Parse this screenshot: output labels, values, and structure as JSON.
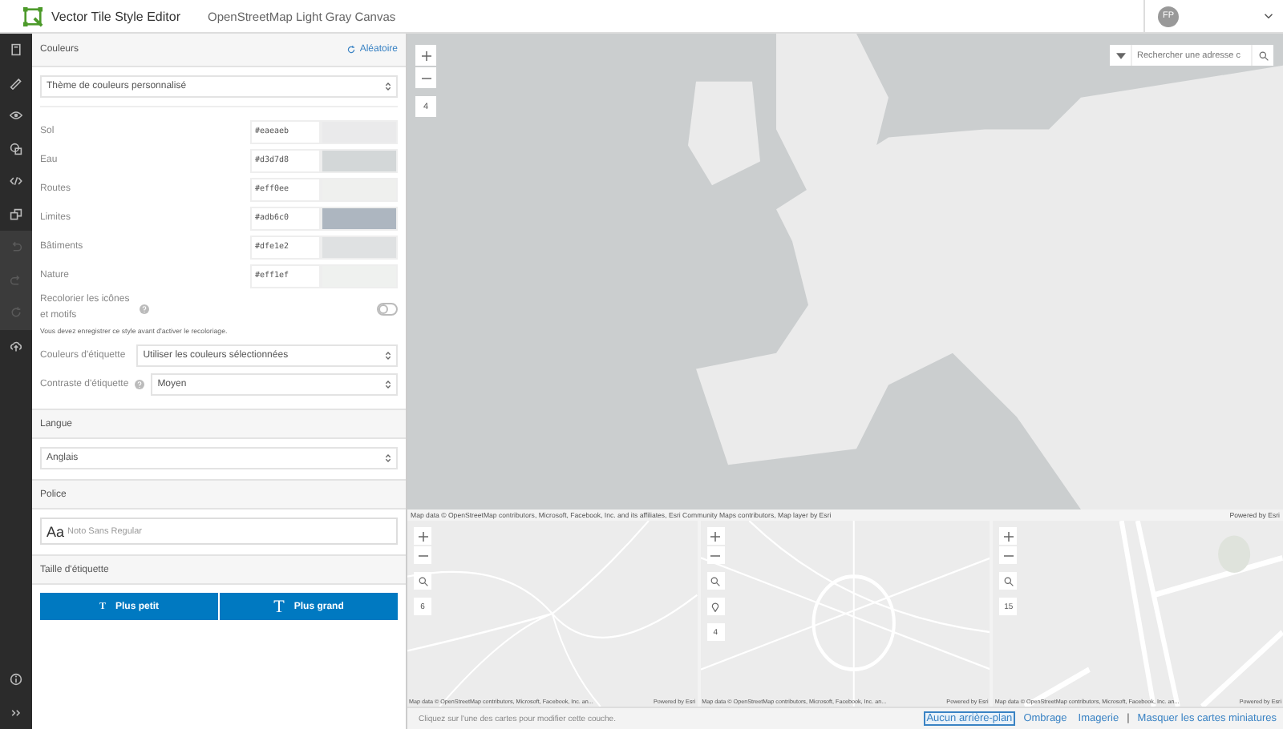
{
  "header": {
    "app_title": "Vector Tile Style Editor",
    "map_title": "OpenStreetMap Light Gray Canvas",
    "user": {
      "initials": "FP"
    }
  },
  "rail": {
    "items": [
      {
        "disabled": false
      },
      {
        "disabled": false
      },
      {
        "disabled": false
      },
      {
        "disabled": false
      },
      {
        "disabled": false
      },
      {
        "disabled": false
      },
      {
        "disabled": true
      },
      {
        "disabled": true
      },
      {
        "disabled": true
      },
      {
        "disabled": false
      }
    ]
  },
  "colors": {
    "title": "Couleurs",
    "random": "Aléatoire",
    "theme": "Thème de couleurs personnalisé",
    "rows": [
      {
        "label": "Sol",
        "hex": "#eaeaeb",
        "color": "#eaeaeb"
      },
      {
        "label": "Eau",
        "hex": "#d3d7d8",
        "color": "#d3d7d8"
      },
      {
        "label": "Routes",
        "hex": "#eff0ee",
        "color": "#eff0ee"
      },
      {
        "label": "Limites",
        "hex": "#adb6c0",
        "color": "#adb6c0"
      },
      {
        "label": "Bâtiments",
        "hex": "#dfe1e2",
        "color": "#dfe1e2"
      },
      {
        "label": "Nature",
        "hex": "#eff1ef",
        "color": "#eff1ef"
      }
    ],
    "recolor": {
      "label": "Recolorier les icônes et motifs",
      "on": false,
      "note": "Vous devez enregistrer ce style avant d'activer le recoloriage."
    },
    "selects": [
      {
        "label": "Couleurs d'étiquette",
        "value": "Utiliser les couleurs sélectionnées",
        "help": false
      },
      {
        "label": "Contraste d'étiquette",
        "value": "Moyen",
        "help": true
      }
    ]
  },
  "language": {
    "title": "Langue",
    "value": "Anglais"
  },
  "font": {
    "title": "Police",
    "sample": "Aa",
    "value": "Noto Sans Regular"
  },
  "label_size": {
    "title": "Taille d'étiquette",
    "buttons": [
      {
        "icon": "T",
        "label": "Plus petit",
        "kind": "smaller"
      },
      {
        "icon": "T",
        "label": "Plus grand",
        "kind": "larger"
      }
    ]
  },
  "map": {
    "zoom_level": "4",
    "search": {
      "placeholder": "Rechercher une adresse c"
    },
    "attribution": "Map data © OpenStreetMap contributors, Microsoft, Facebook, Inc. and its affiliates, Esri Community Maps contributors, Map layer by Esri",
    "powered": "Powered by Esri"
  },
  "minimaps": [
    {
      "zoom_level": "6",
      "pin": false,
      "attribution": "Map data © OpenStreetMap contributors, Microsoft, Facebook, Inc. an...",
      "powered": "Powered by Esri"
    },
    {
      "zoom_level": "4",
      "pin": true,
      "attribution": "Map data © OpenStreetMap contributors, Microsoft, Facebook, Inc. an...",
      "powered": "Powered by Esri"
    },
    {
      "zoom_level": "15",
      "pin": false,
      "attribution": "Map data © OpenStreetMap contributors, Microsoft, Facebook, Inc. an...",
      "powered": "Powered by Esri"
    }
  ],
  "footer": {
    "hint": "Cliquez sur l'une des cartes pour modifier cette couche.",
    "links": [
      {
        "kind": "link",
        "label": "Aucun arrière-plan",
        "selected": true
      },
      {
        "kind": "link",
        "label": "Ombrage",
        "selected": false
      },
      {
        "kind": "link",
        "label": "Imagerie",
        "selected": false
      },
      {
        "kind": "separator",
        "label": "|"
      },
      {
        "kind": "link",
        "label": "Masquer les cartes miniatures",
        "selected": false
      }
    ]
  }
}
